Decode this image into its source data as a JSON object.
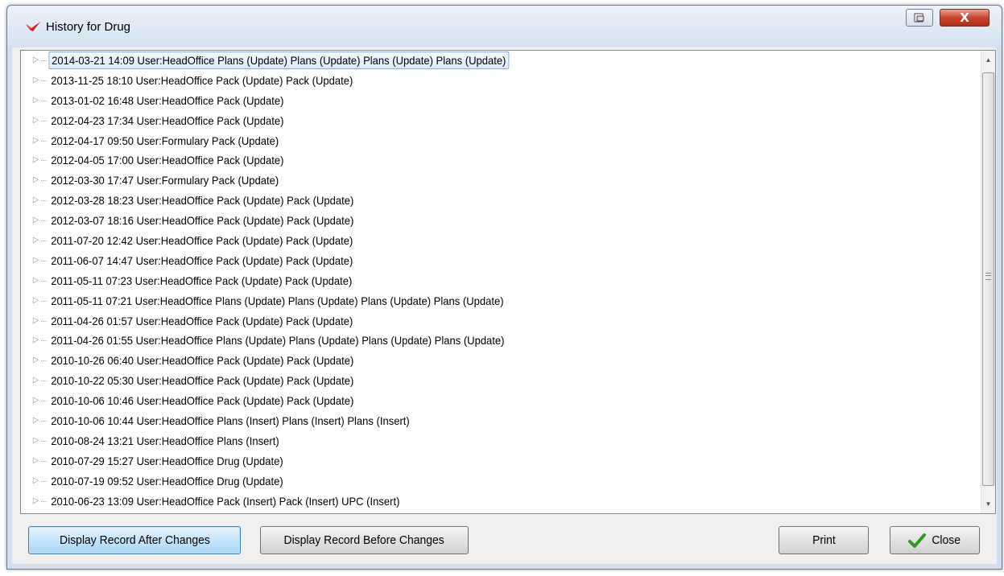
{
  "window": {
    "title": "History for Drug",
    "close_glyph": "X"
  },
  "history": {
    "rows": [
      {
        "text": "2014-03-21 14:09 User:HeadOffice  Plans (Update) Plans (Update) Plans (Update) Plans (Update)",
        "selected": true
      },
      {
        "text": "2013-11-25 18:10 User:HeadOffice  Pack (Update) Pack (Update)"
      },
      {
        "text": "2013-01-02 16:48 User:HeadOffice  Pack (Update)"
      },
      {
        "text": "2012-04-23 17:34 User:HeadOffice  Pack (Update)"
      },
      {
        "text": "2012-04-17 09:50 User:Formulary  Pack (Update)"
      },
      {
        "text": "2012-04-05 17:00 User:HeadOffice  Pack (Update)"
      },
      {
        "text": "2012-03-30 17:47 User:Formulary  Pack (Update)"
      },
      {
        "text": "2012-03-28 18:23 User:HeadOffice  Pack (Update) Pack (Update)"
      },
      {
        "text": "2012-03-07 18:16 User:HeadOffice  Pack (Update) Pack (Update)"
      },
      {
        "text": "2011-07-20 12:42 User:HeadOffice  Pack (Update) Pack (Update)"
      },
      {
        "text": "2011-06-07 14:47 User:HeadOffice  Pack (Update) Pack (Update)"
      },
      {
        "text": "2011-05-11 07:23 User:HeadOffice  Pack (Update) Pack (Update)"
      },
      {
        "text": "2011-05-11 07:21 User:HeadOffice  Plans (Update) Plans (Update) Plans (Update) Plans (Update)"
      },
      {
        "text": "2011-04-26 01:57 User:HeadOffice  Pack (Update) Pack (Update)"
      },
      {
        "text": "2011-04-26 01:55 User:HeadOffice  Plans (Update) Plans (Update) Plans (Update) Plans (Update)"
      },
      {
        "text": "2010-10-26 06:40 User:HeadOffice  Pack (Update) Pack (Update)"
      },
      {
        "text": "2010-10-22 05:30 User:HeadOffice  Pack (Update) Pack (Update)"
      },
      {
        "text": "2010-10-06 10:46 User:HeadOffice  Pack (Update) Pack (Update)"
      },
      {
        "text": "2010-10-06 10:44 User:HeadOffice  Plans (Insert) Plans (Insert) Plans (Insert)"
      },
      {
        "text": "2010-08-24 13:21 User:HeadOffice  Plans (Insert)"
      },
      {
        "text": "2010-07-29 15:27 User:HeadOffice  Drug (Update)"
      },
      {
        "text": "2010-07-19 09:52 User:HeadOffice  Drug (Update)"
      },
      {
        "text": "2010-06-23 13:09 User:HeadOffice  Pack (Insert) Pack (Insert) UPC (Insert)"
      }
    ]
  },
  "buttons": {
    "after_changes": "Display Record After Changes",
    "before_changes": "Display Record Before Changes",
    "print": "Print",
    "close": "Close"
  },
  "icons": {
    "app": "drug-icon",
    "expander": "triangle-right-icon",
    "check": "checkmark-icon"
  },
  "colors": {
    "accent": "#3c7fb1",
    "close_red": "#c7432c",
    "check_green": "#2e9a1e"
  }
}
